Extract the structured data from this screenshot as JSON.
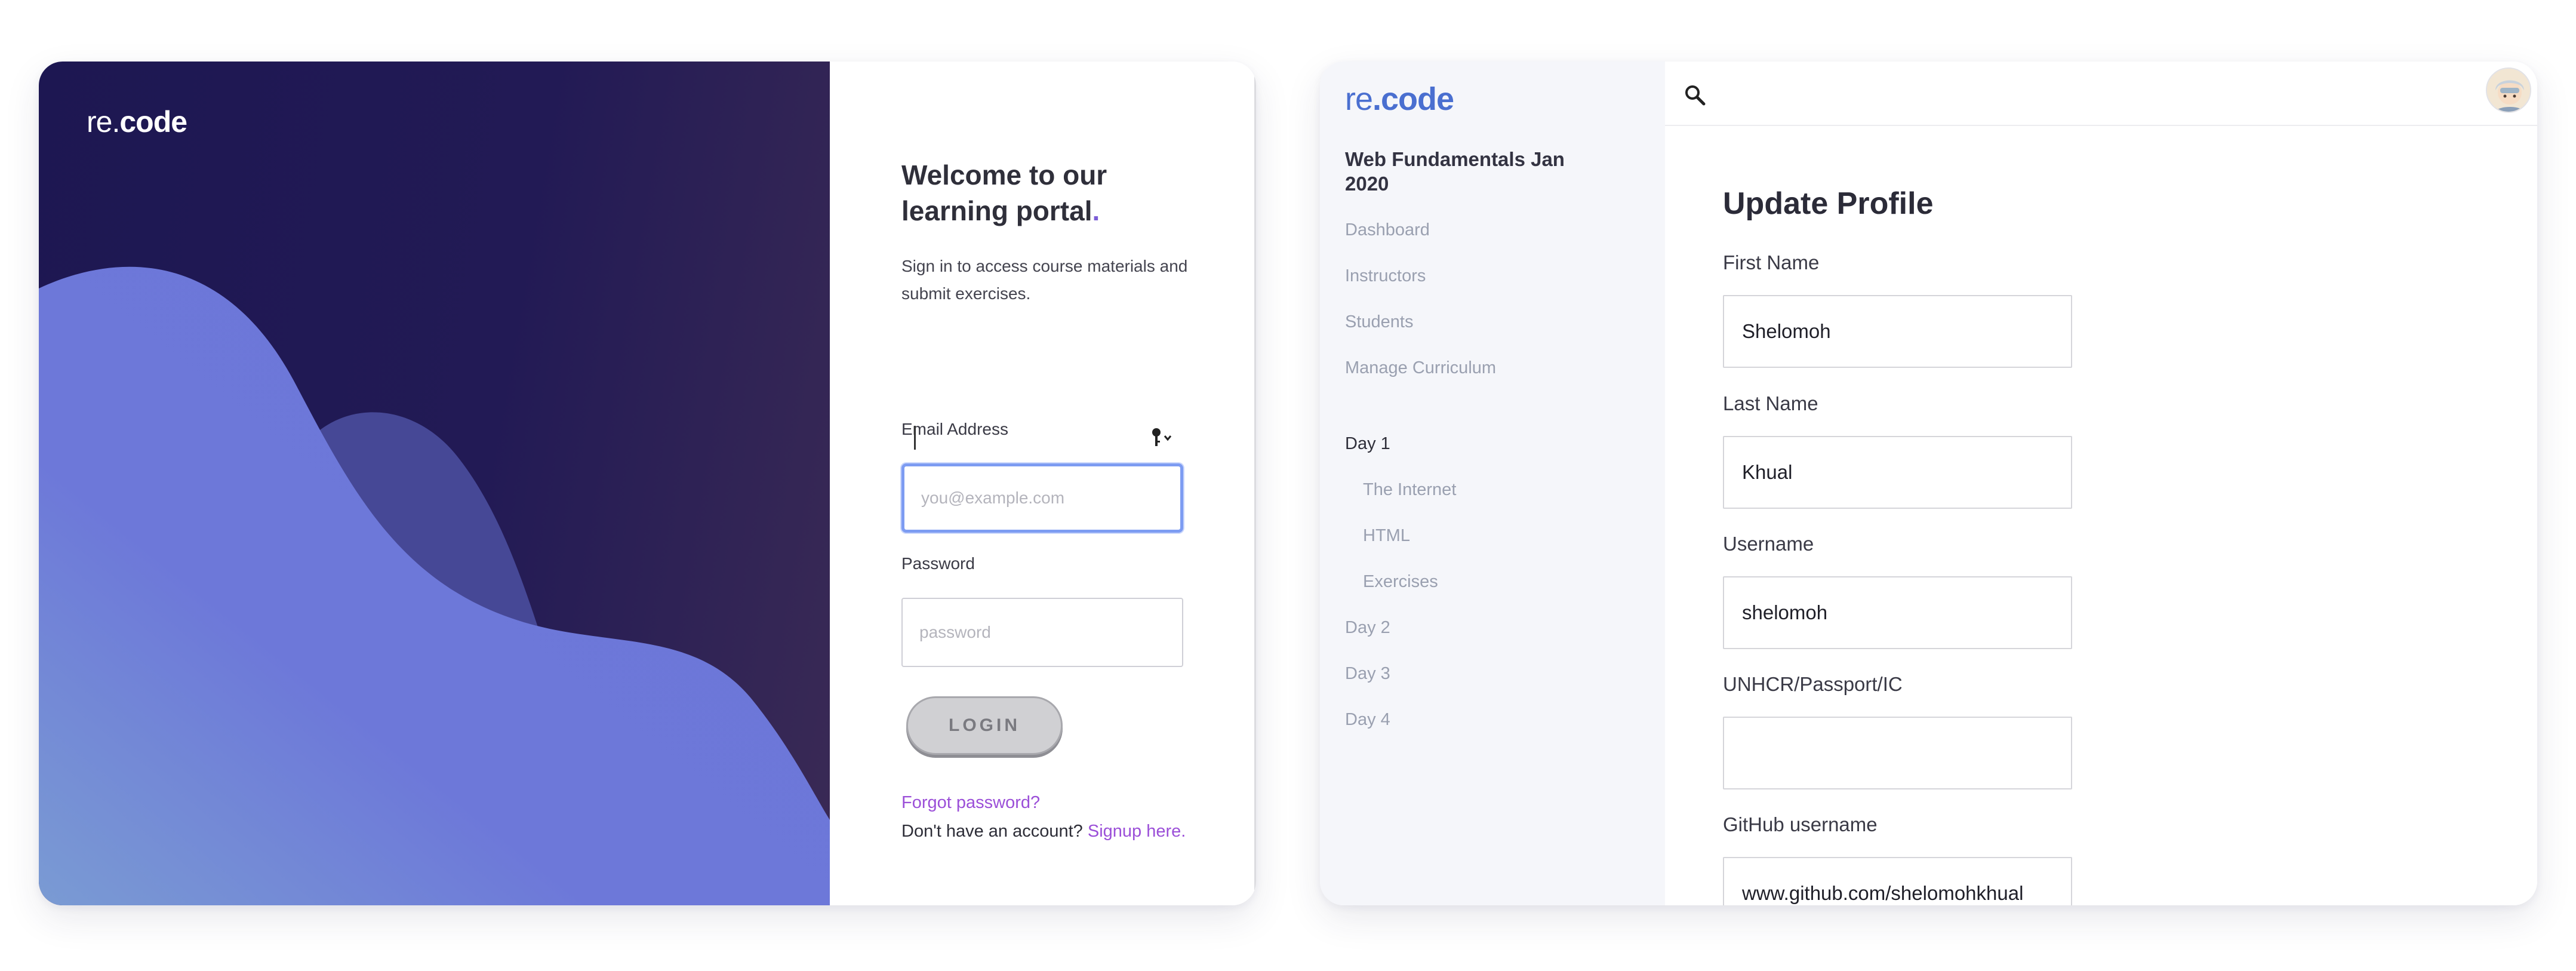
{
  "login": {
    "logo_light": "re.",
    "logo_bold": "code",
    "welcome_line1": "Welcome to our",
    "welcome_line2": "learning portal",
    "welcome_dot": ".",
    "subtitle": "Sign in to access course materials and submit exercises.",
    "email_label": "Email Address",
    "email_placeholder": "you@example.com",
    "password_label": "Password",
    "password_placeholder": "password",
    "login_button": "LOGIN",
    "forgot_link": "Forgot password?",
    "no_account_text": "Don't have an account? ",
    "signup_link": "Signup here."
  },
  "portal": {
    "logo_light": "re",
    "logo_bold": ".code",
    "course_title": "Web Fundamentals Jan 2020",
    "nav": [
      {
        "label": "Dashboard"
      },
      {
        "label": "Instructors"
      },
      {
        "label": "Students"
      },
      {
        "label": "Manage Curriculum"
      }
    ],
    "curriculum": [
      {
        "label": "Day 1"
      },
      {
        "label": "The Internet"
      },
      {
        "label": "HTML"
      },
      {
        "label": "Exercises"
      },
      {
        "label": "Day 2"
      },
      {
        "label": "Day 3"
      },
      {
        "label": "Day 4"
      }
    ],
    "page_title": "Update Profile",
    "fields": [
      {
        "label": "First Name",
        "value": "Shelomoh"
      },
      {
        "label": "Last Name",
        "value": "Khual"
      },
      {
        "label": "Username",
        "value": "shelomoh"
      },
      {
        "label": "UNHCR/Passport/IC",
        "value": ""
      },
      {
        "label": "GitHub username",
        "value": "www.github.com/shelomohkhual"
      }
    ]
  },
  "colors": {
    "hero_dark": "#1d1752",
    "hero_wave": "#6d78d9",
    "accent_purple": "#9b4fd8",
    "brand_blue": "#4a6fd0"
  }
}
